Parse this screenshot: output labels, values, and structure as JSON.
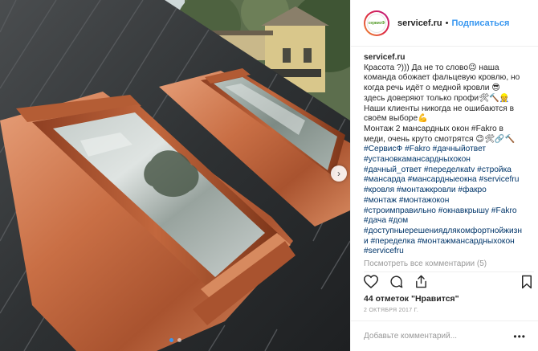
{
  "header": {
    "username": "servicef.ru",
    "separator": "•",
    "follow_label": "Подписаться",
    "avatar_logo": "сервисФ"
  },
  "caption": {
    "username": "servicef.ru",
    "lines": [
      "Красота ?))) Да не то слово😉 наша",
      "команда обожает фальцевую кровлю, но",
      "когда речь идёт о медной кровли 😎",
      "здесь доверяют только профи🛠🔨👷",
      "Наши клиенты никогда не ошибаются в",
      "своём выборе💪",
      "Монтаж 2 мансардных окон #Fakro в",
      "меди, очень круто смотрятся 😉🛠🔗🔨"
    ],
    "tag_lines": [
      "#СервисФ #Fakro #дачныйответ",
      "#установкамансардныхокон",
      "#дачный_ответ #переделкаtv #стройка",
      "#мансарда #мансардныеокна #servicefru",
      "#кровля #монтажкровли #факро",
      "#монтаж #монтажокон",
      "#строимправильно #окнавкрышу #Fakro",
      "#дача #дом",
      "#доступныерешениядлякомфортнойжизн",
      "и #переделка #монтажмансардныхокон",
      "#servicefru"
    ]
  },
  "more_comments": "Посмотреть все комментарии (5)",
  "likes": {
    "count": "44",
    "label_mid": "отметок",
    "label_end": "\"Нравится\""
  },
  "date": "2 ОКТЯБРЯ 2017 Г.",
  "comment_input": {
    "placeholder": "Добавьте комментарий...",
    "value": ""
  },
  "more_options": "•••",
  "icons": {
    "like": "heart-icon",
    "comment": "comment-icon",
    "share": "share-icon",
    "save": "bookmark-icon",
    "next": "chevron-right-icon"
  },
  "colors": {
    "accent": "#3897f0",
    "hashtag": "#003569",
    "muted": "#999999",
    "copper": "#c06b42"
  },
  "carousel": {
    "total": 2,
    "active": 1
  }
}
